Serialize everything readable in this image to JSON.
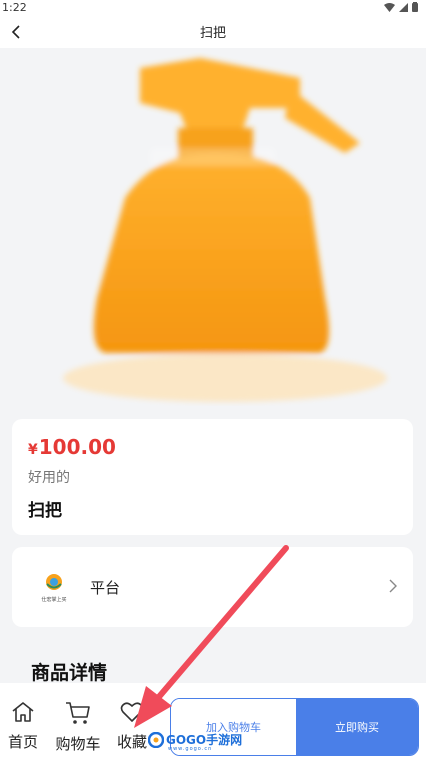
{
  "status_bar": {
    "time": "1:22"
  },
  "nav": {
    "title": "扫把"
  },
  "product": {
    "currency": "¥",
    "price": "100.00",
    "subtitle": "好用的",
    "name": "扫把"
  },
  "platform": {
    "logo_text": "仕宏掌上买",
    "name": "平台"
  },
  "details": {
    "title": "商品详情"
  },
  "bottom_bar": {
    "home_label": "首页",
    "cart_label": "购物车",
    "favorite_label": "收藏",
    "add_to_cart_label": "加入购物车",
    "buy_now_label": "立即购买"
  },
  "watermark": {
    "text": "GOGO手游网",
    "sub": "www.gogo.cn"
  },
  "colors": {
    "price_red": "#e53935",
    "primary_blue": "#4a7fe8",
    "annotation_arrow": "#f04b5a",
    "product_orange": "#f7a21d"
  }
}
